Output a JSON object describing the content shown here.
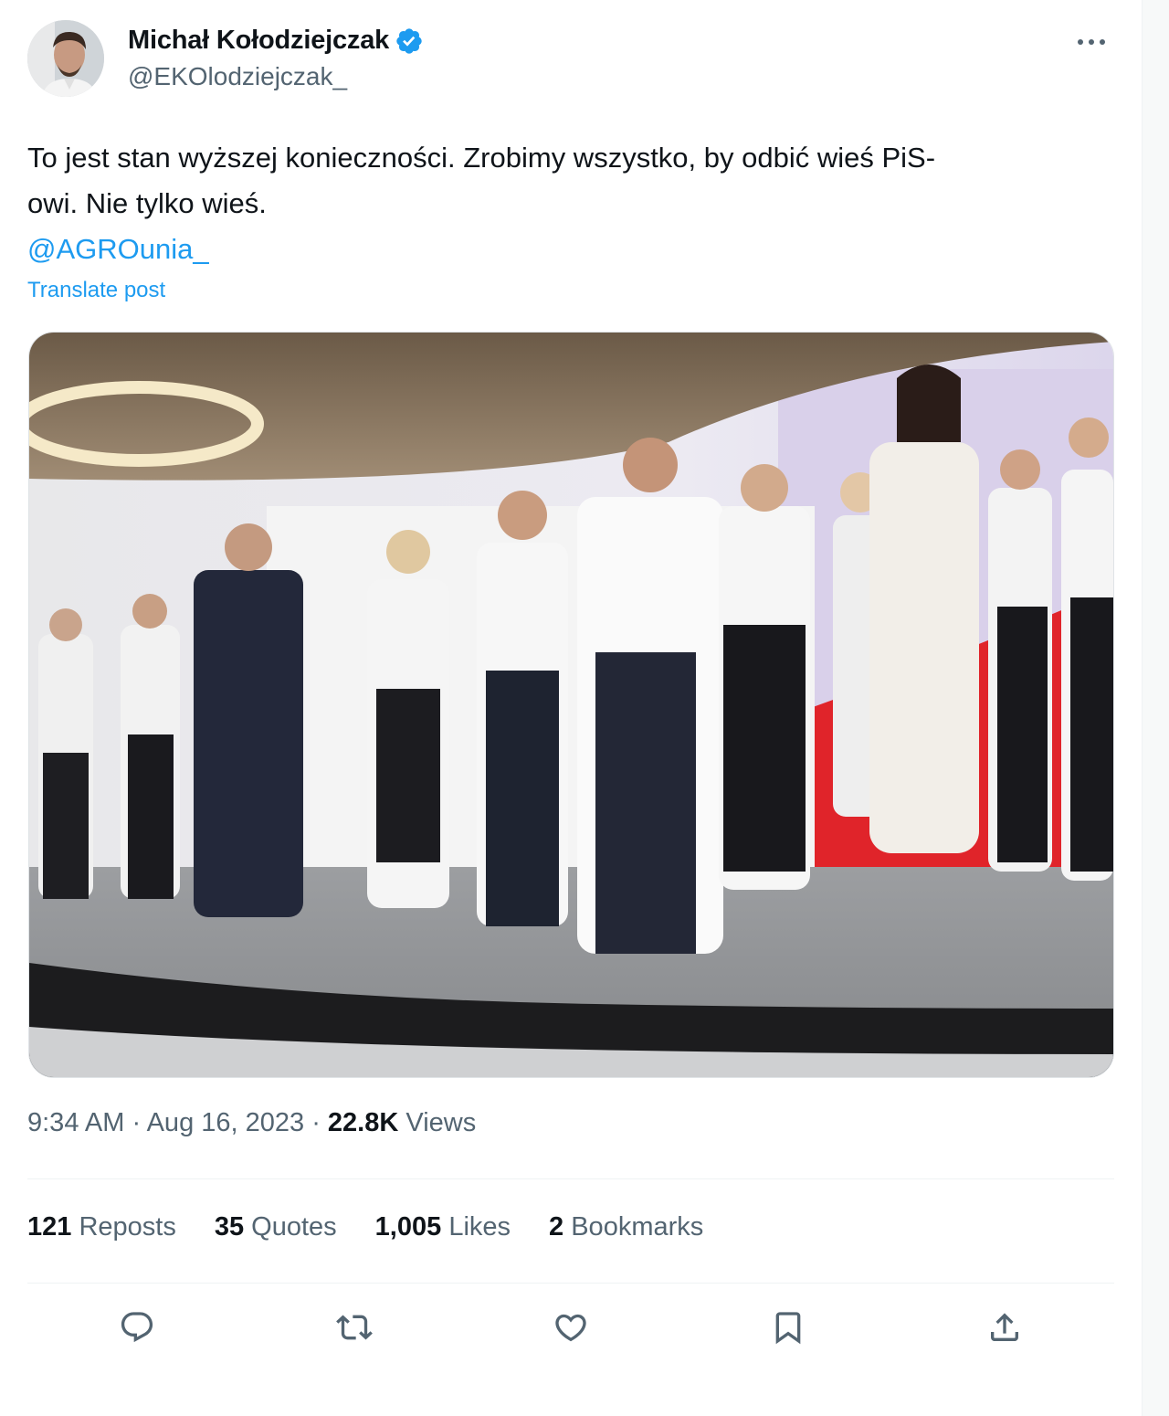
{
  "author": {
    "display_name": "Michał Kołodziejczak",
    "handle": "@EKOlodziejczak_"
  },
  "tweet": {
    "text_line1": "To jest stan wyższej konieczności. Zrobimy wszystko, by odbić wieś PiS-",
    "text_line2": "owi. Nie tylko wieś.",
    "mention": "@AGROunia_",
    "translate_label": "Translate post"
  },
  "meta": {
    "time": "9:34 AM",
    "date": "Aug 16, 2023",
    "views_count": "22.8K",
    "views_label": "Views"
  },
  "stats": {
    "reposts_count": "121",
    "reposts_label": "Reposts",
    "quotes_count": "35",
    "quotes_label": "Quotes",
    "likes_count": "1,005",
    "likes_label": "Likes",
    "bookmarks_count": "2",
    "bookmarks_label": "Bookmarks"
  },
  "icons": [
    "verified-badge-icon",
    "more-options-icon",
    "reply-icon",
    "repost-icon",
    "like-icon",
    "bookmark-icon",
    "share-icon"
  ],
  "colors": {
    "accent": "#1d9bf0",
    "text_primary": "#0f1419",
    "text_secondary": "#536471"
  }
}
